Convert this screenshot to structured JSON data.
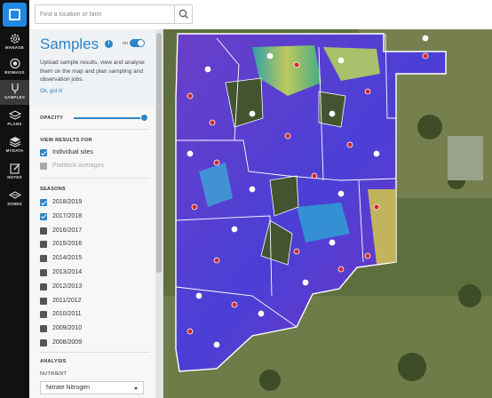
{
  "rail": {
    "items": [
      {
        "label": "MANAGE",
        "icon": "gear-icon"
      },
      {
        "label": "BIOMASS",
        "icon": "biomass-icon"
      },
      {
        "label": "SAMPLES",
        "icon": "samples-icon"
      },
      {
        "label": "PLANS",
        "icon": "layers-icon"
      },
      {
        "label": "MYDATA",
        "icon": "layers-stack-icon"
      },
      {
        "label": "NOTES",
        "icon": "edit-note-icon"
      },
      {
        "label": "ZONES",
        "icon": "zones-icon"
      }
    ]
  },
  "search": {
    "placeholder": "Find a location or farm",
    "icon": "search-icon"
  },
  "panel": {
    "title": "Samples",
    "toggle_label": "on",
    "description": "Upload sample results, view and analyse them on the map and plan sampling and observation jobs.",
    "link": "Ok, got it!",
    "opacity_label": "OPACITY",
    "opacity_value": 0.95,
    "view_results_label": "VIEW RESULTS FOR",
    "view_results": [
      {
        "label": "Individual sites",
        "checked": true,
        "disabled": false
      },
      {
        "label": "Paddock averages",
        "checked": false,
        "disabled": true
      }
    ],
    "seasons_label": "SEASONS",
    "seasons": [
      {
        "label": "2018/2019",
        "checked": true
      },
      {
        "label": "2017/2018",
        "checked": true
      },
      {
        "label": "2016/2017",
        "checked": false
      },
      {
        "label": "2015/2016",
        "checked": false
      },
      {
        "label": "2014/2015",
        "checked": false
      },
      {
        "label": "2013/2014",
        "checked": false
      },
      {
        "label": "2012/2013",
        "checked": false
      },
      {
        "label": "2011/2012",
        "checked": false
      },
      {
        "label": "2010/2011",
        "checked": false
      },
      {
        "label": "2009/2010",
        "checked": false
      },
      {
        "label": "2008/2009",
        "checked": false
      }
    ],
    "analysis_label": "ANALYSIS",
    "nutrient_label": "NUTRIENT",
    "nutrient_value": "Nitrate Nitrogen"
  },
  "colors": {
    "accent": "#2f84c6",
    "rail": "#111111",
    "logo": "#1e88e5"
  }
}
